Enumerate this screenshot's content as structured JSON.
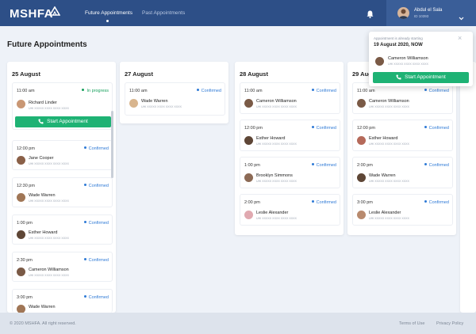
{
  "header": {
    "brand": "MSHFA",
    "nav": {
      "future": "Future Appointments",
      "past": "Past Appointments"
    },
    "user": {
      "name": "Abdul el Sala",
      "id": "ID 10393"
    },
    "icons": {
      "notifications": "bell-icon",
      "menu": "chevron-down-icon"
    }
  },
  "page_title": "Future Appointments",
  "patient_id": "UHI XXXXX XXXX XXXX XXXX",
  "actions": {
    "start": "Start Appointment"
  },
  "columns": [
    {
      "date": "25 August",
      "items": [
        {
          "time": "11:00 am",
          "status": "In progress",
          "name": "Richard Linder"
        },
        {
          "time": "12:00 pm",
          "status": "Confirmed",
          "name": "Jane Cooper"
        },
        {
          "time": "12:30 pm",
          "status": "Confirmed",
          "name": "Wade Warren"
        },
        {
          "time": "1:00 pm",
          "status": "Confirmed",
          "name": "Esther Howard"
        },
        {
          "time": "2:30 pm",
          "status": "Confirmed",
          "name": "Cameron Williamson"
        },
        {
          "time": "3:00 pm",
          "status": "Confirmed",
          "name": "Wade Warren"
        }
      ]
    },
    {
      "date": "27 August",
      "items": [
        {
          "time": "11:00 am",
          "status": "Confirmed",
          "name": "Wade Warren"
        }
      ]
    },
    {
      "date": "28 August",
      "items": [
        {
          "time": "11:00 am",
          "status": "Confirmed",
          "name": "Cameron Williamson"
        },
        {
          "time": "12:00 pm",
          "status": "Confirmed",
          "name": "Esther Howard"
        },
        {
          "time": "1:00 pm",
          "status": "Confirmed",
          "name": "Brooklyn Simmons"
        },
        {
          "time": "2:00 pm",
          "status": "Confirmed",
          "name": "Leslie Alexander"
        }
      ]
    },
    {
      "date": "29 August",
      "items": [
        {
          "time": "11:00 am",
          "status": "Confirmed",
          "name": "Cameron Williamson"
        },
        {
          "time": "12:00 pm",
          "status": "Confirmed",
          "name": "Esther Howard"
        },
        {
          "time": "2:00 pm",
          "status": "Confirmed",
          "name": "Wade Warren"
        },
        {
          "time": "3:00 pm",
          "status": "Confirmed",
          "name": "Leslie Alexander"
        }
      ]
    }
  ],
  "popup": {
    "note": "Appointment is already starting",
    "date": "19 August 2020, NOW",
    "name": "Cameron Williamson",
    "close": "×"
  },
  "footer": {
    "copyright": "© 2020 MSHFA. All right reserved.",
    "terms": "Terms of Use",
    "privacy": "Privacy Policy"
  },
  "colors": {
    "header": "#2d4f87",
    "accent": "#1eb274",
    "confirmed": "#2f7ad6",
    "progress": "#17a05d"
  }
}
